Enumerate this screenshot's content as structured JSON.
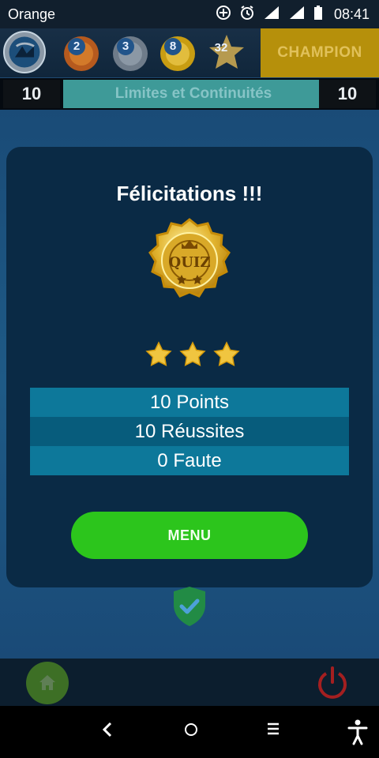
{
  "status_bar": {
    "carrier": "Orange",
    "time": "08:41",
    "icons": [
      "data-saver-icon",
      "alarm-icon",
      "signal-icon",
      "signal-icon",
      "battery-icon"
    ]
  },
  "header": {
    "medals": [
      {
        "name": "bronze-medal",
        "count": "2"
      },
      {
        "name": "silver-medal",
        "count": "3"
      },
      {
        "name": "gold-medal",
        "count": "8"
      },
      {
        "name": "star-medal",
        "count": "32"
      }
    ],
    "rank_label": "CHAMPION",
    "left_score": "10",
    "chapter_title": "Limites et Continuités",
    "right_score": "10"
  },
  "result_card": {
    "title": "Félicitations !!!",
    "badge_text": "QUIZ",
    "stars": 3,
    "lines": [
      "10 Points",
      "10 Réussites",
      "0 Faute"
    ],
    "menu_label": "MENU"
  },
  "colors": {
    "accent": "#2cc51c",
    "card": "#0a2a45",
    "champion": "#b6900b"
  }
}
